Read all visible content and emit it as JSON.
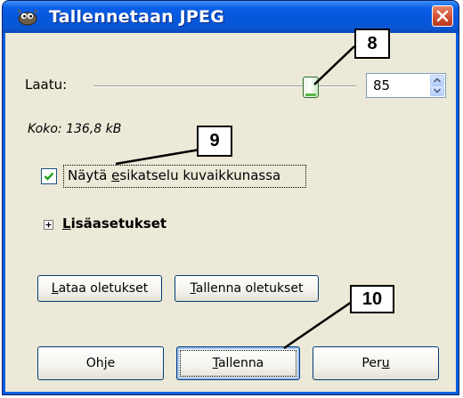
{
  "window": {
    "title": "Tallennetaan JPEG",
    "icon": "gimp-wilber-icon",
    "close_icon": "close-icon"
  },
  "quality": {
    "label": "Laatu:",
    "value": "85",
    "slider_fraction": 0.85
  },
  "file_size": "Koko: 136,8 kB",
  "preview": {
    "checked": true,
    "label_pre": "Näytä ",
    "label_mnemonic": "e",
    "label_post": "sikatselu kuvaikkunassa"
  },
  "advanced": {
    "expander_symbol": "+",
    "label_mnemonic": "L",
    "label_rest": "isäasetukset"
  },
  "defaults_buttons": {
    "load": {
      "mnemonic": "L",
      "rest": "ataa oletukset"
    },
    "save": {
      "mnemonic": "T",
      "rest": "allenna oletukset"
    }
  },
  "dialog_buttons": {
    "help": {
      "pre": "Oh",
      "mnemonic": "j",
      "post": "e"
    },
    "save": {
      "pre": "",
      "mnemonic": "T",
      "post": "allenna"
    },
    "cancel": {
      "pre": "Per",
      "mnemonic": "u",
      "post": ""
    }
  },
  "callouts": [
    "8",
    "9",
    "10"
  ],
  "colors": {
    "titlebar": "#0a5fe6",
    "dialog_bg": "#ece9d8",
    "checkmark": "#21a121",
    "slider_thumb": "#5bb848"
  }
}
